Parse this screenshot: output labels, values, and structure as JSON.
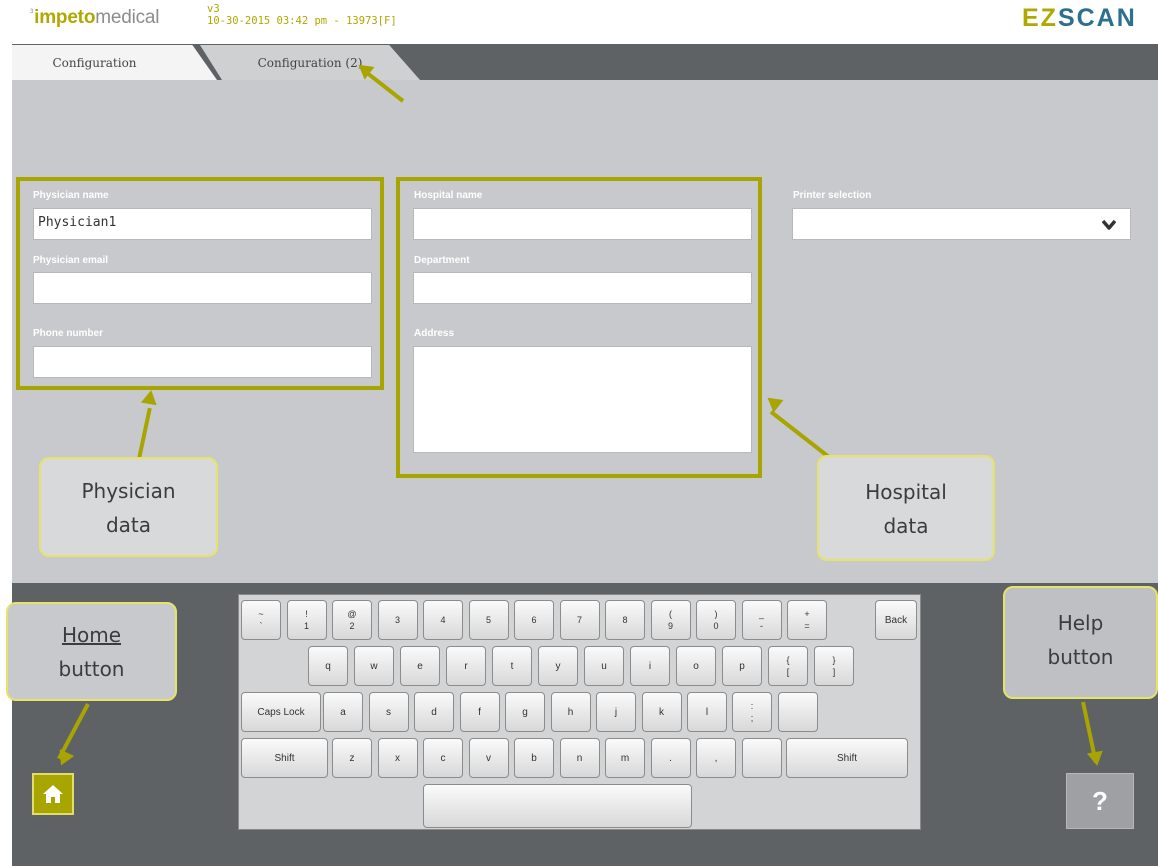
{
  "header": {
    "logo_prefix": "impeto",
    "logo_suffix": "medical",
    "version": "v3",
    "session": "10-30-2015 03:42 pm - 13973[F]",
    "brand_ez": "EZ",
    "brand_scan": "SCAN"
  },
  "tabs": [
    {
      "label": "Configuration",
      "active": true
    },
    {
      "label": "Configuration (2)",
      "active": false
    }
  ],
  "physician": {
    "name_label": "Physician name",
    "name_value": "Physician1",
    "email_label": "Physician email",
    "email_value": "",
    "phone_label": "Phone number",
    "phone_value": ""
  },
  "hospital": {
    "name_label": "Hospital name",
    "name_value": "",
    "department_label": "Department",
    "department_value": "",
    "address_label": "Address",
    "address_value": ""
  },
  "printer": {
    "label": "Printer selection",
    "selected": ""
  },
  "callouts": {
    "physician": [
      "Physician",
      "data"
    ],
    "hospital": [
      "Hospital",
      "data"
    ],
    "home": [
      "Home",
      "button"
    ],
    "help": [
      "Help",
      "button"
    ]
  },
  "keyboard": {
    "row1": [
      {
        "top": "~",
        "bottom": "`"
      },
      {
        "top": "!",
        "bottom": "1"
      },
      {
        "top": "@",
        "bottom": "2"
      },
      {
        "top": "",
        "bottom": "3"
      },
      {
        "top": "",
        "bottom": "4"
      },
      {
        "top": "",
        "bottom": "5"
      },
      {
        "top": "",
        "bottom": "6"
      },
      {
        "top": "",
        "bottom": "7"
      },
      {
        "top": "",
        "bottom": "8"
      },
      {
        "top": "(",
        "bottom": "9"
      },
      {
        "top": ")",
        "bottom": "0"
      },
      {
        "top": "_",
        "bottom": "-"
      },
      {
        "top": "+",
        "bottom": "="
      }
    ],
    "back": "Back",
    "row2": [
      "q",
      "w",
      "e",
      "r",
      "t",
      "y",
      "u",
      "i",
      "o",
      "p"
    ],
    "row2_extra": [
      {
        "top": "{",
        "bottom": "["
      },
      {
        "top": "}",
        "bottom": "]"
      }
    ],
    "caps": "Caps Lock",
    "row3": [
      "a",
      "s",
      "d",
      "f",
      "g",
      "h",
      "j",
      "k",
      "l"
    ],
    "row3_extra": [
      {
        "top": ":",
        "bottom": ";"
      },
      {
        "top": "",
        "bottom": ""
      }
    ],
    "shift": "Shift",
    "row4": [
      "z",
      "x",
      "c",
      "v",
      "b",
      "n",
      "m",
      ".",
      ",",
      ""
    ]
  },
  "help_symbol": "?",
  "icons": {
    "home": "home-icon",
    "dropdown": "chevron-down-icon"
  },
  "colors": {
    "accent": "#a8a400",
    "brand_blue": "#2d6f8c",
    "panel": "#c8c9cc",
    "dark": "#5f6265"
  }
}
